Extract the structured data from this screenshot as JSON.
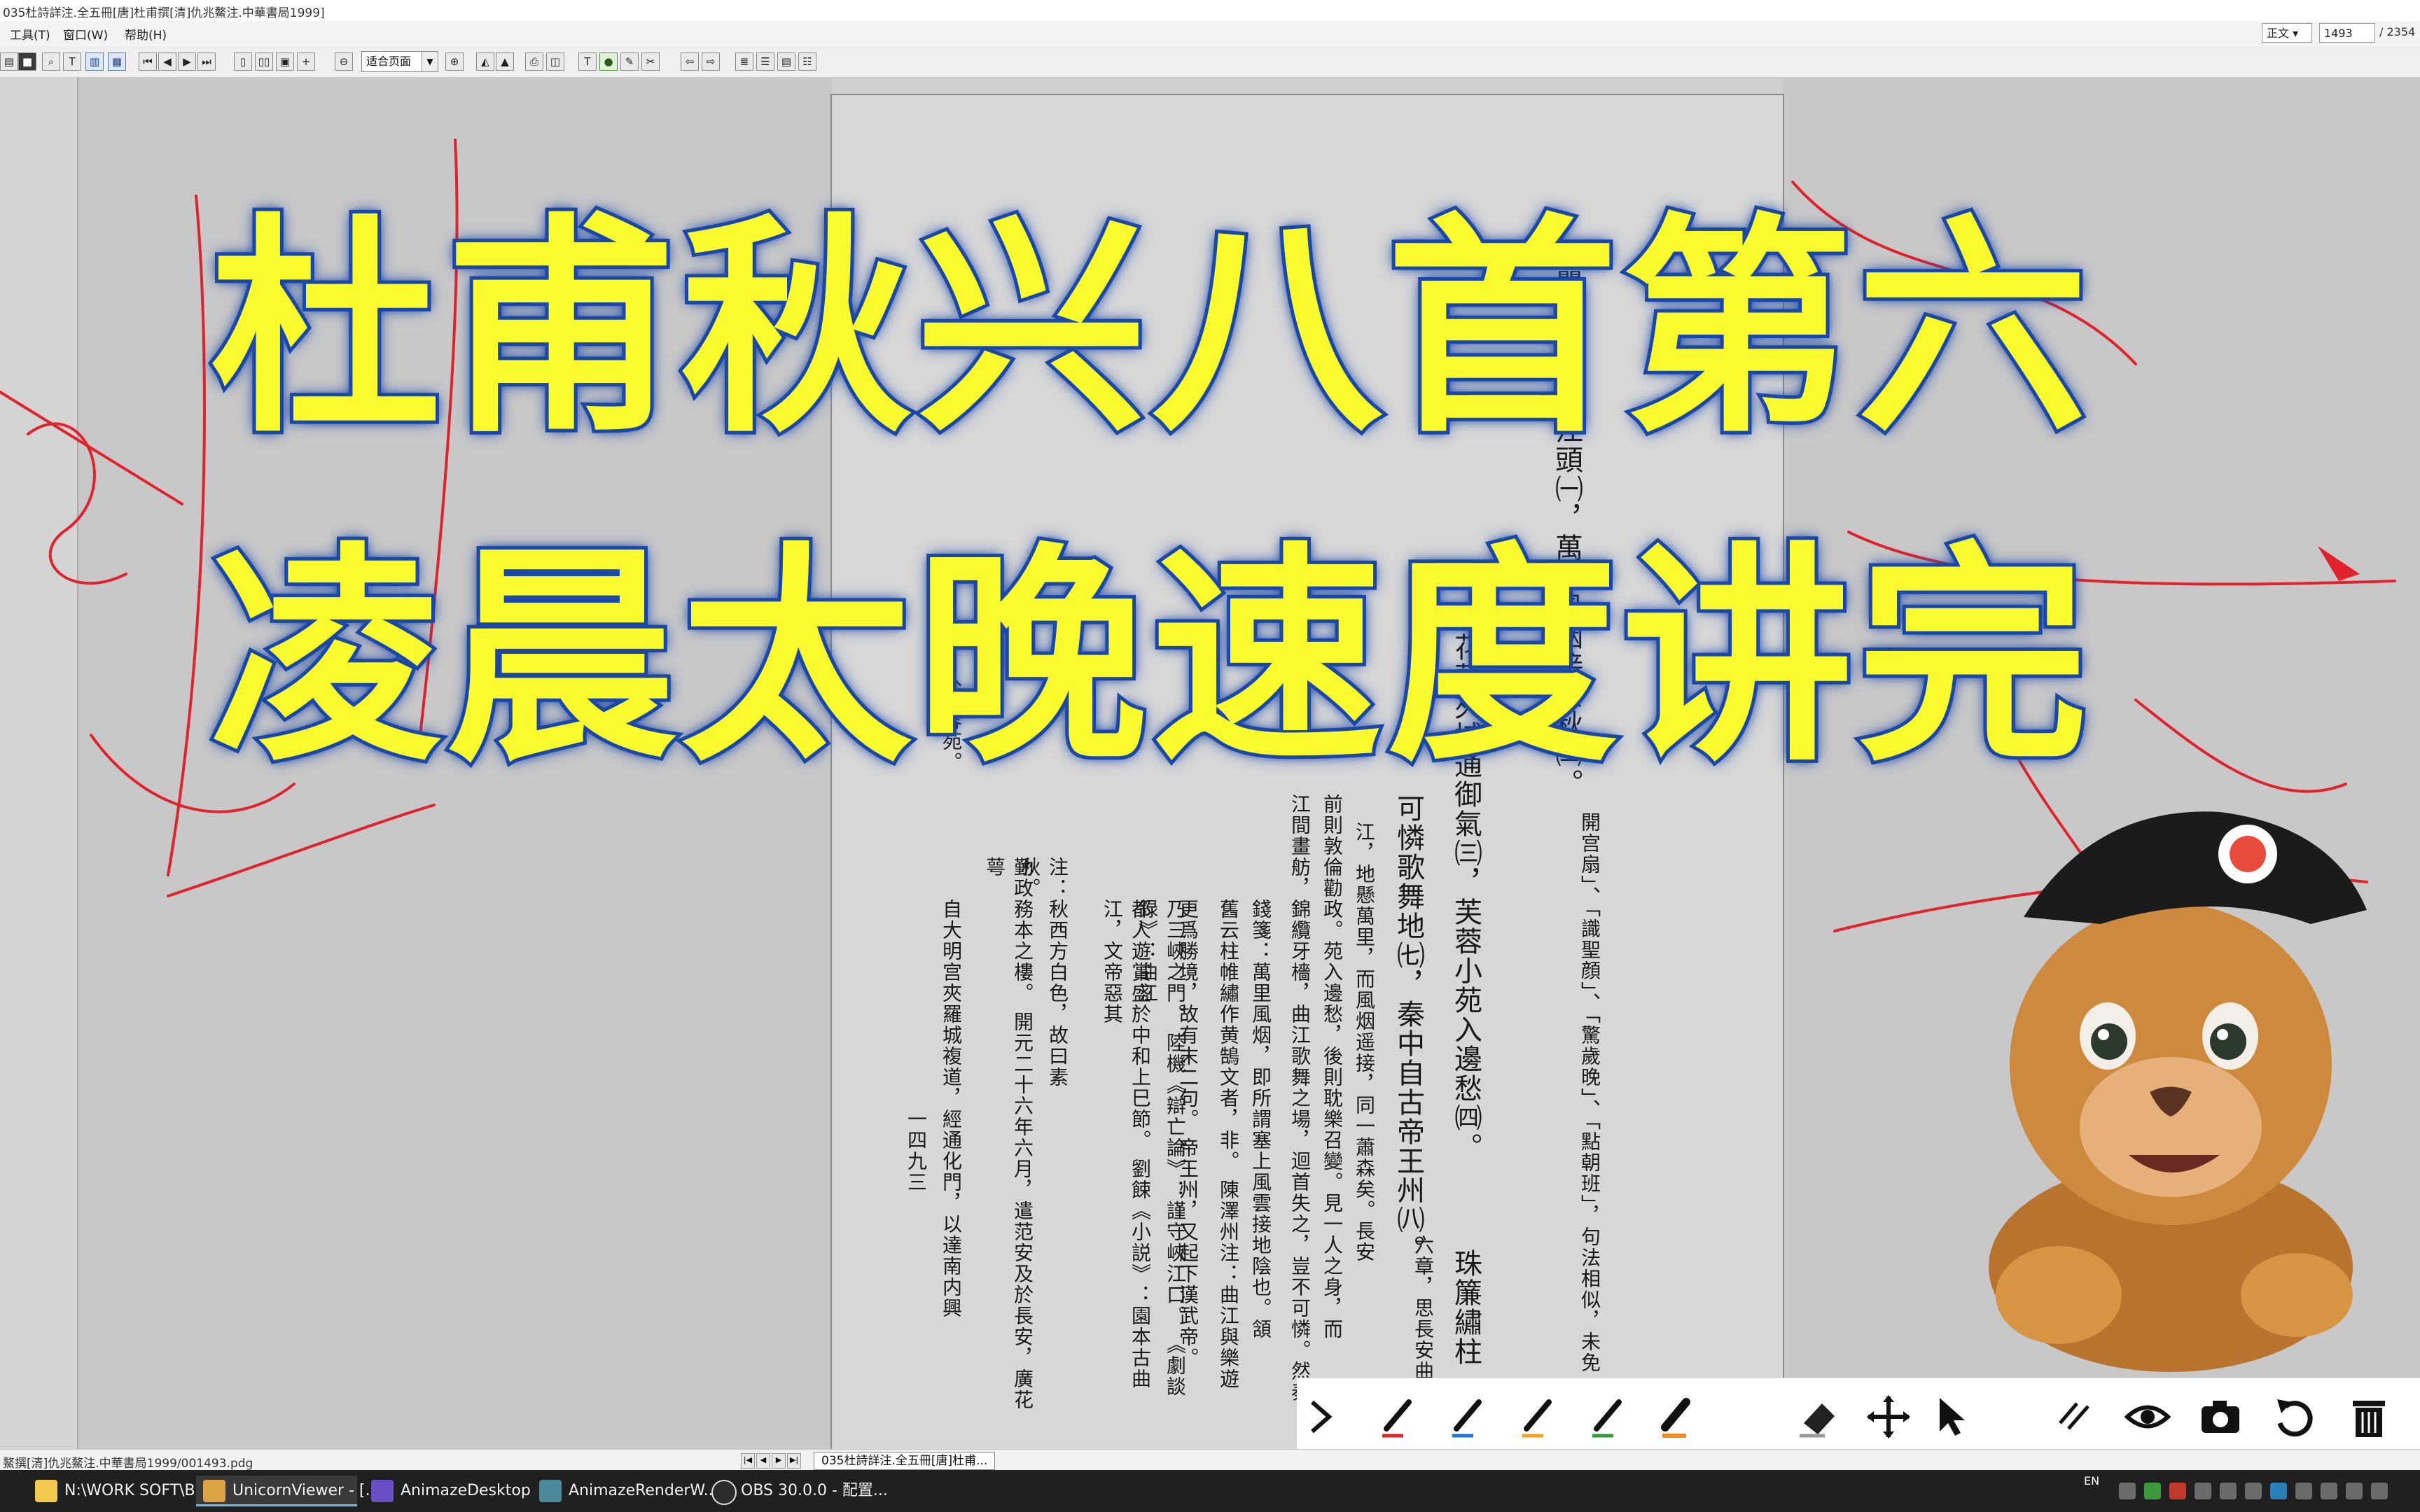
{
  "window": {
    "title": "035杜詩詳注.全五冊[唐]杜甫撰[清]仇兆鰲注.中華書局1999]"
  },
  "menu": {
    "items": [
      "工具(T)",
      "窗口(W)",
      "帮助(H)"
    ],
    "view_mode": "正文",
    "page_current": "1493",
    "page_total": "/ 2354"
  },
  "toolbar": {
    "zoom_value": "适合页面"
  },
  "overlay": {
    "title_line1": "杜甫秋兴八首第六",
    "title_line2": "凌晨太晚速度讲完",
    "text_color": "#f9fb2e",
    "outline_color": "#1d49a8",
    "scribble_color": "#e0232c"
  },
  "page_text": {
    "main_columns": [
      "瞿唐峽口曲江頭㈠，萬里風烟接素秋㈡。",
      "花萼夾城通御氣㈢，芙蓉小苑入邊愁㈣。",
      "珠簾繡柱",
      "可憐歌舞地㈦，秦中自古帝王州㈧。"
    ],
    "note_columns": [
      "六章，思長安曲",
      "江，地懸萬里，而風烟遥接，同一蕭森矣。長安",
      "前則敦倫勸政。苑入邊愁，後則耽樂召變。見一人之身，而",
      "江間畫舫，錦纜牙檣，曲江歌舞之場，迴首失之，豈不可憐。然秦",
      "錢箋：萬里風烟，即所謂塞上風雲接地陰也。頷",
      "舊云柱帷繡作黄鵠文者，非。 陳澤州注：曲江與樂遊",
      "更爲勝境，故有末二句。 帝王州，又起下漢武帝。",
      "乃三峽之門。 陸機《辯亡論》：謹守峽江口。 《劇談録》：曲江",
      "都人遊賞盛於中和上巳節。 劉餗《小説》：園本古曲江，文帝惡其",
      "注：秋西方白色，故曰素秋。",
      "勤政務本之樓。 開元二十六年六月，遣范安及於長安，廣花萼",
      "自大明宫夾羅城複道，經通化門，以達南内興",
      "入芙蓉苑。",
      "一四九三"
    ],
    "right_margin_column": "開宫扇」、「識聖顔」、「驚歲晚」、「點朝班」，句法相似，未免"
  },
  "palette": {
    "tools": [
      "expand-chevron",
      "red-pen",
      "blue-pen",
      "orange-pen",
      "green-pen",
      "highlighter",
      "eraser",
      "move",
      "pointer",
      "lines",
      "eye",
      "camera",
      "undo",
      "trash"
    ]
  },
  "statusbar": {
    "file_path": "鰲撰[清]仇兆鰲注.中華書局1999/001493.pdg",
    "document_tab": "035杜詩詳注.全五冊[唐]杜甫..."
  },
  "taskbar": {
    "apps": [
      {
        "label": "N:\\WORK SOFT\\B...",
        "active": false
      },
      {
        "label": "UnicornViewer - [...",
        "active": true
      },
      {
        "label": "AnimazeDesktop",
        "active": false
      },
      {
        "label": "AnimazeRenderW...",
        "active": false
      },
      {
        "label": "OBS 30.0.0 - 配置...",
        "active": false
      }
    ],
    "tray_lang": "EN"
  }
}
